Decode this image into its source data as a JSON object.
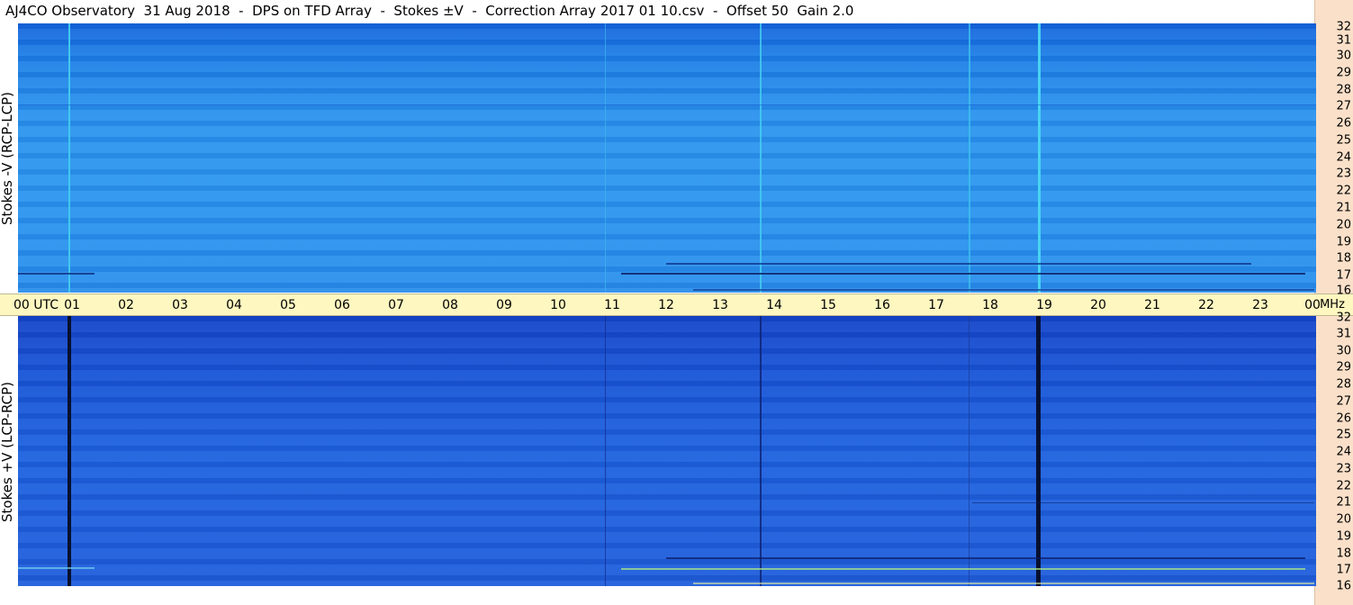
{
  "title": "AJ4CO Observatory  31 Aug 2018  -  DPS on TFD Array  -  Stokes ±V  -  Correction Array 2017 01 10.csv  -  Offset 50  Gain 2.0",
  "panels": {
    "top_label": "Stokes -V (RCP-LCP)",
    "bottom_label": "Stokes +V (LCP-RCP)"
  },
  "time_axis": {
    "labels": [
      "00  UTC",
      "01",
      "02",
      "03",
      "04",
      "05",
      "06",
      "07",
      "08",
      "09",
      "10",
      "11",
      "12",
      "13",
      "14",
      "15",
      "16",
      "17",
      "18",
      "19",
      "20",
      "21",
      "22",
      "23",
      "00"
    ],
    "unit": "MHz"
  },
  "freq_axis": {
    "top": [
      "32",
      "31",
      "30",
      "29",
      "28",
      "27",
      "26",
      "25",
      "24",
      "23",
      "22",
      "21",
      "20",
      "19",
      "18",
      "17",
      "16"
    ],
    "bottom": [
      "32",
      "31",
      "30",
      "29",
      "28",
      "27",
      "26",
      "25",
      "24",
      "23",
      "22",
      "21",
      "20",
      "19",
      "18",
      "17",
      "16"
    ]
  },
  "colors": {
    "timebar": "#fff7c0",
    "right_strip": "#fbe0c9",
    "spectrogram_top": "#2b94ee",
    "spectrogram_bottom": "#1f63df"
  }
}
